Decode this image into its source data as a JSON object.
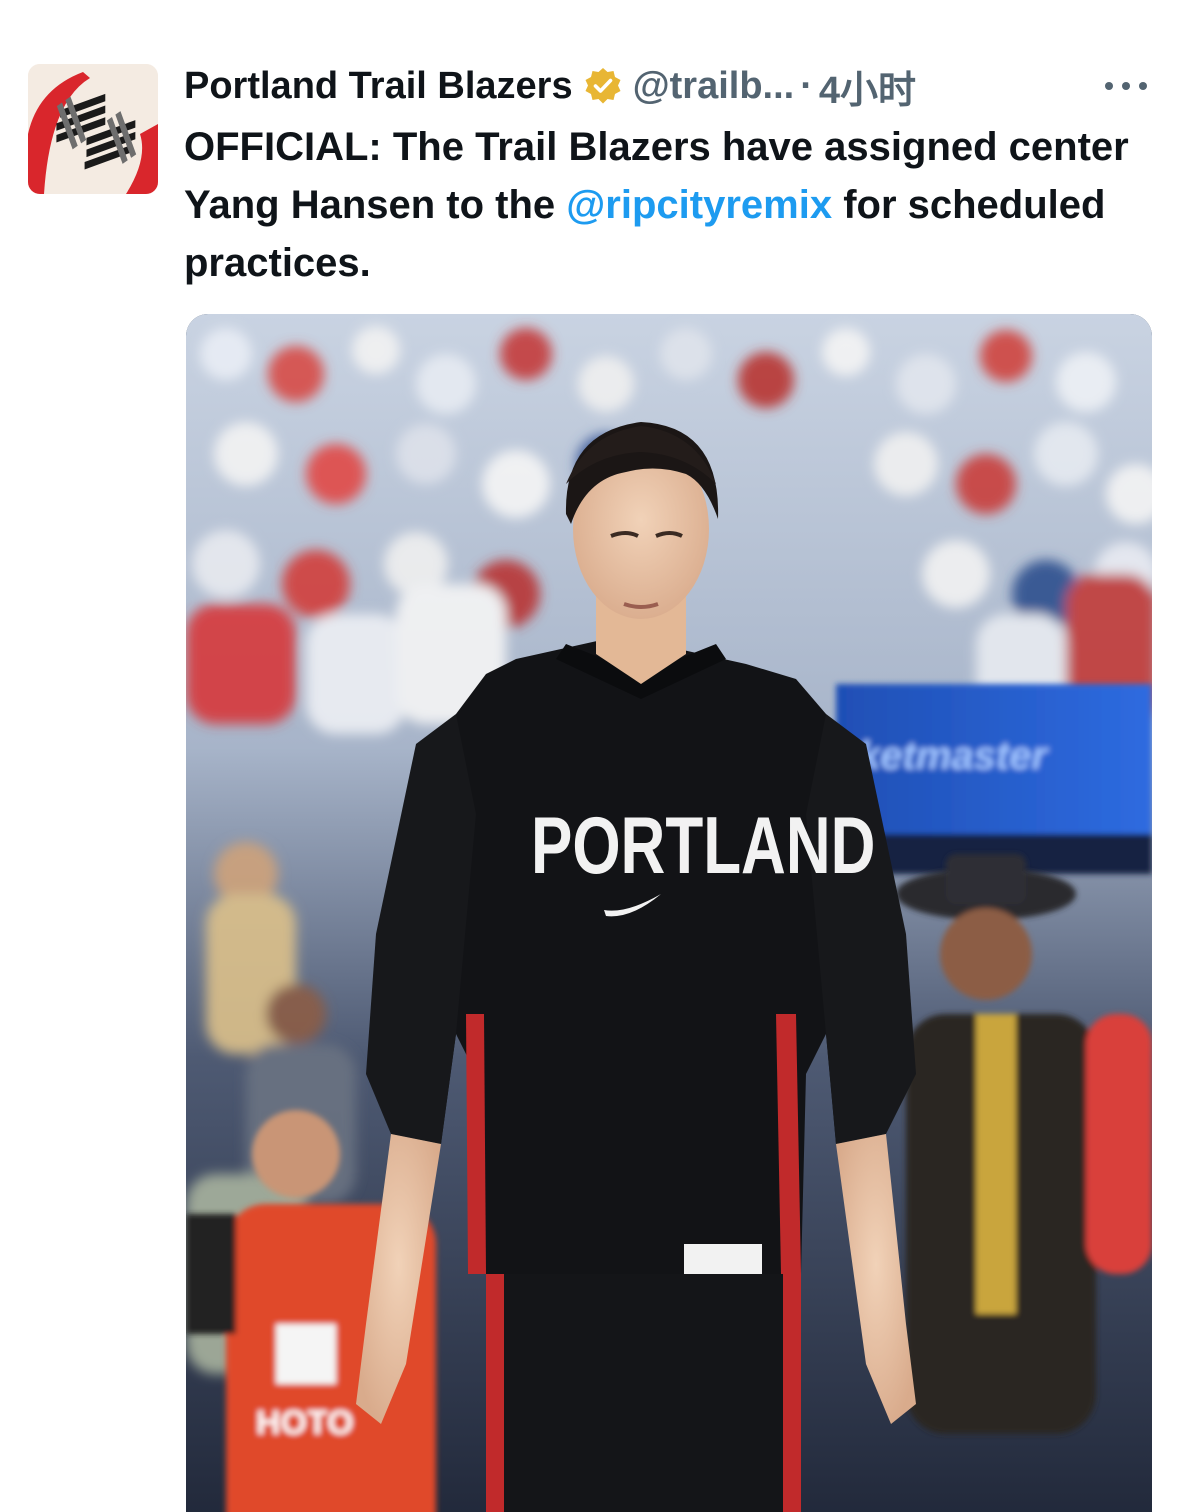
{
  "tweet": {
    "author": {
      "display_name": "Portland Trail Blazers",
      "handle": "@trailb...",
      "verified": true,
      "avatar_icon": "trail-blazers-pinwheel-logo"
    },
    "separator": "·",
    "timestamp": "4小时",
    "more_icon": "more-horizontal-icon",
    "text": {
      "part1": "OFFICIAL: The Trail Blazers have assigned center Yang Hansen to the ",
      "mention": "@ripcityremix",
      "part2": " for scheduled practices."
    },
    "media": {
      "jersey_text": "PORTLAND",
      "banner_text": "ketmaster",
      "vest_text": "HOTO"
    }
  },
  "colors": {
    "text_primary": "#0f1419",
    "text_secondary": "#536471",
    "link": "#1d9bf0",
    "verified_gold": "#e8b634",
    "blazers_red": "#e03a3e"
  }
}
